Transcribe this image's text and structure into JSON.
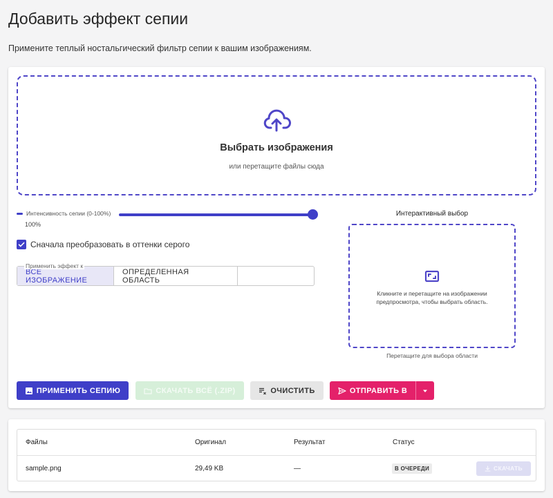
{
  "header": {
    "title": "Добавить эффект сепии",
    "subtitle": "Примените теплый ностальгический фильтр сепии к вашим изображениям."
  },
  "dropzone": {
    "title": "Выбрать изображения",
    "subtitle": "или перетащите файлы сюда"
  },
  "intensity": {
    "label": "Интенсивность сепии (0-100%)",
    "value_text": "100%",
    "value": 100
  },
  "grayscale": {
    "label": "Сначала преобразовать в оттенки серого",
    "checked": true
  },
  "apply_to": {
    "label": "Применить эффект к",
    "options": [
      "ВСЁ ИЗОБРАЖЕНИЕ",
      "ОПРЕДЕЛЕННАЯ ОБЛАСТЬ"
    ],
    "selected": "ВСЁ ИЗОБРАЖЕНИЕ"
  },
  "interactive": {
    "title": "Интерактивный выбор",
    "box_text": "Кликните и перетащите на изображении предпросмотра, чтобы выбрать область.",
    "hint": "Перетащите для выбора области"
  },
  "actions": {
    "apply": "ПРИМЕНИТЬ СЕПИЮ",
    "download_all": "СКАЧАТЬ ВСЁ (.ZIP)",
    "clear": "ОЧИСТИТЬ",
    "send": "ОТПРАВИТЬ В"
  },
  "files": {
    "columns": [
      "Файлы",
      "Оригинал",
      "Результат",
      "Статус"
    ],
    "rows": [
      {
        "name": "sample.png",
        "original": "29,49 KB",
        "result": "—",
        "status": "В ОЧЕРЕДИ",
        "download": "СКАЧАТЬ"
      }
    ]
  },
  "colors": {
    "accent": "#3f3fc8",
    "send": "#e4216a",
    "download_disabled": "#d6efd9"
  },
  "icons": [
    "cloud-upload-icon",
    "check-icon",
    "crop-select-icon",
    "image-icon",
    "folder-icon",
    "clear-list-icon",
    "send-icon",
    "caret-down-icon",
    "download-icon"
  ]
}
